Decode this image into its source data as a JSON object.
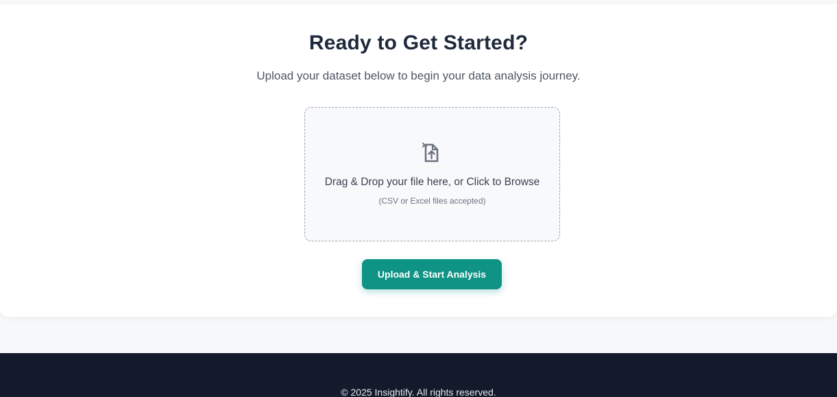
{
  "hero": {
    "title": "Ready to Get Started?",
    "subtitle": "Upload your dataset below to begin your data analysis journey."
  },
  "dropzone": {
    "icon": "file-upload-icon",
    "main_text": "Drag & Drop your file here, or Click to Browse",
    "hint_text": "(CSV or Excel files accepted)"
  },
  "actions": {
    "upload_label": "Upload & Start Analysis"
  },
  "footer": {
    "copyright": "© 2025 Insightify. All rights reserved."
  },
  "colors": {
    "accent": "#0e9384",
    "footer_bg": "#121a2c",
    "title": "#1e293b"
  }
}
